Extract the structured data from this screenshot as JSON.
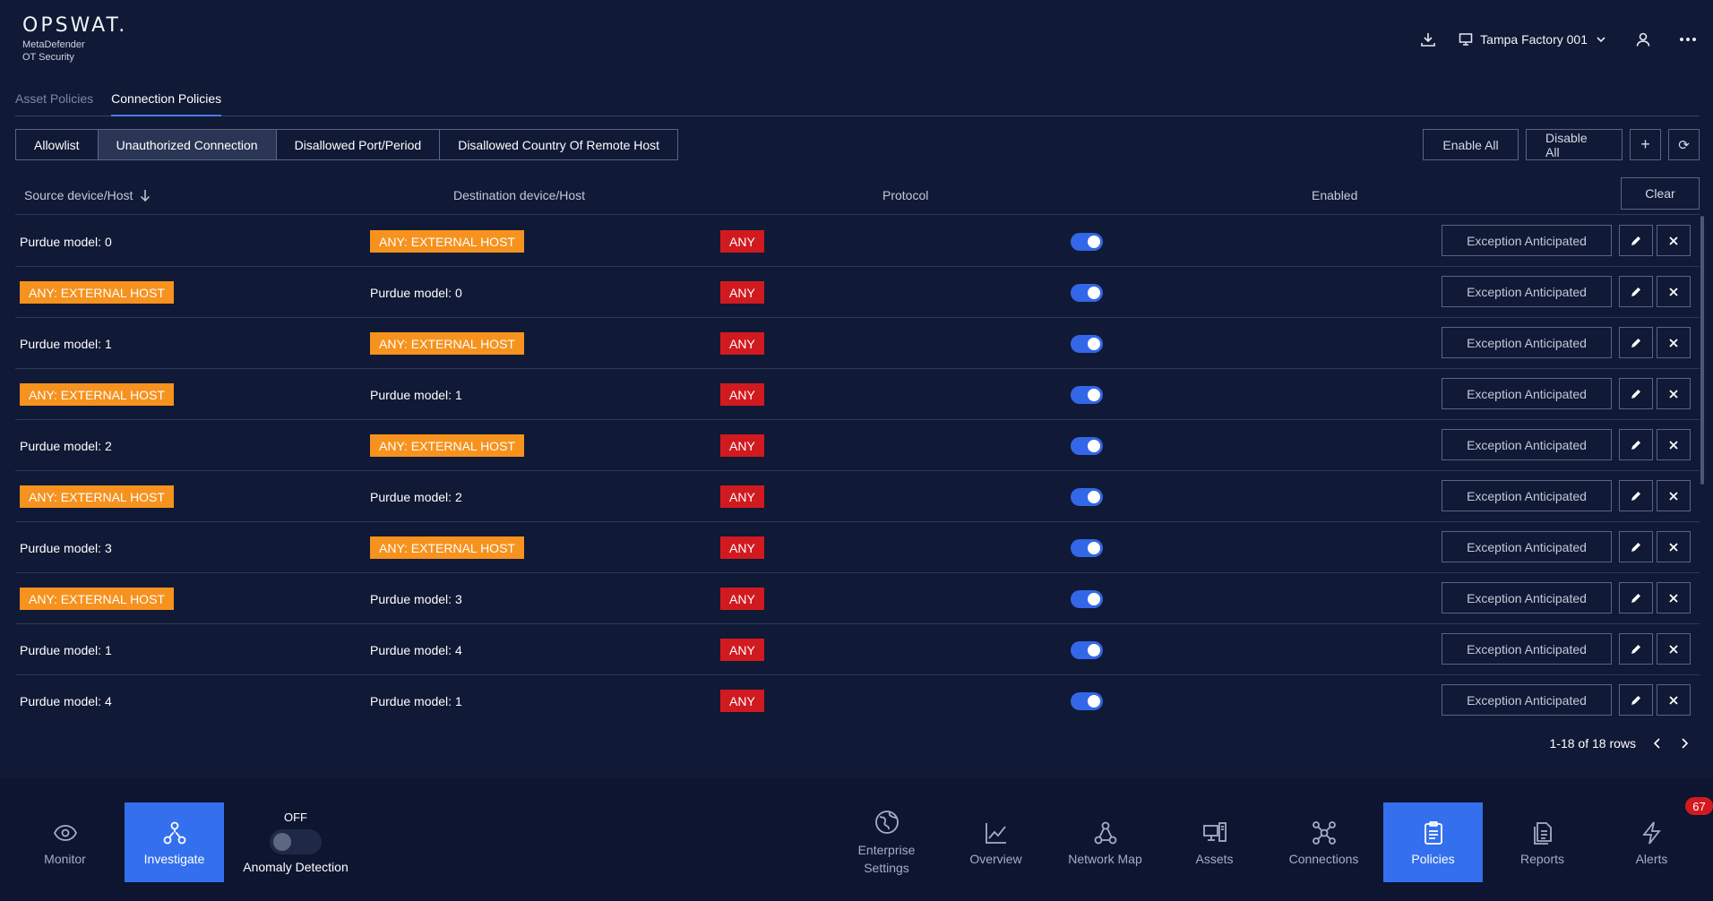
{
  "brand": {
    "name": "OPSWAT.",
    "product_line1": "MetaDefender",
    "product_line2": "OT Security"
  },
  "header": {
    "site": "Tampa Factory 001"
  },
  "tabs": [
    {
      "label": "Asset Policies",
      "active": false
    },
    {
      "label": "Connection Policies",
      "active": true
    }
  ],
  "policy_types": [
    {
      "label": "Allowlist",
      "active": false
    },
    {
      "label": "Unauthorized Connection",
      "active": true
    },
    {
      "label": "Disallowed Port/Period",
      "active": false
    },
    {
      "label": "Disallowed Country Of Remote Host",
      "active": false
    }
  ],
  "toolbar": {
    "enable_all": "Enable All",
    "disable_all": "Disable All",
    "add_symbol": "+",
    "refresh_symbol": "⟳"
  },
  "table": {
    "columns": {
      "source": "Source device/Host",
      "destination": "Destination device/Host",
      "protocol": "Protocol",
      "enabled": "Enabled"
    },
    "clear_label": "Clear",
    "exception_label": "Exception Anticipated",
    "rows": [
      {
        "source": "Purdue model: 0",
        "source_external": false,
        "destination": "ANY: EXTERNAL HOST",
        "destination_external": true,
        "protocol": "ANY",
        "enabled": true
      },
      {
        "source": "ANY: EXTERNAL HOST",
        "source_external": true,
        "destination": "Purdue model: 0",
        "destination_external": false,
        "protocol": "ANY",
        "enabled": true
      },
      {
        "source": "Purdue model: 1",
        "source_external": false,
        "destination": "ANY: EXTERNAL HOST",
        "destination_external": true,
        "protocol": "ANY",
        "enabled": true
      },
      {
        "source": "ANY: EXTERNAL HOST",
        "source_external": true,
        "destination": "Purdue model: 1",
        "destination_external": false,
        "protocol": "ANY",
        "enabled": true
      },
      {
        "source": "Purdue model: 2",
        "source_external": false,
        "destination": "ANY: EXTERNAL HOST",
        "destination_external": true,
        "protocol": "ANY",
        "enabled": true
      },
      {
        "source": "ANY: EXTERNAL HOST",
        "source_external": true,
        "destination": "Purdue model: 2",
        "destination_external": false,
        "protocol": "ANY",
        "enabled": true
      },
      {
        "source": "Purdue model: 3",
        "source_external": false,
        "destination": "ANY: EXTERNAL HOST",
        "destination_external": true,
        "protocol": "ANY",
        "enabled": true
      },
      {
        "source": "ANY: EXTERNAL HOST",
        "source_external": true,
        "destination": "Purdue model: 3",
        "destination_external": false,
        "protocol": "ANY",
        "enabled": true
      },
      {
        "source": "Purdue model: 1",
        "source_external": false,
        "destination": "Purdue model: 4",
        "destination_external": false,
        "protocol": "ANY",
        "enabled": true
      },
      {
        "source": "Purdue model: 4",
        "source_external": false,
        "destination": "Purdue model: 1",
        "destination_external": false,
        "protocol": "ANY",
        "enabled": true
      }
    ]
  },
  "pagination": {
    "label": "1-18 of 18 rows"
  },
  "bottom_nav": {
    "left": [
      {
        "key": "monitor",
        "label": "Monitor",
        "icon": "eye-icon",
        "active": false
      },
      {
        "key": "investigate",
        "label": "Investigate",
        "icon": "hierarchy-icon",
        "active": true
      }
    ],
    "anomaly": {
      "state": "OFF",
      "label": "Anomaly Detection"
    },
    "right": [
      {
        "key": "enterprise-settings",
        "label": "Enterprise Settings",
        "icon": "globe-icon",
        "active": false
      },
      {
        "key": "overview",
        "label": "Overview",
        "icon": "line-chart-icon",
        "active": false
      },
      {
        "key": "network-map",
        "label": "Network Map",
        "icon": "network-icon",
        "active": false
      },
      {
        "key": "assets",
        "label": "Assets",
        "icon": "devices-icon",
        "active": false
      },
      {
        "key": "connections",
        "label": "Connections",
        "icon": "connections-icon",
        "active": false
      },
      {
        "key": "policies",
        "label": "Policies",
        "icon": "clipboard-icon",
        "active": true
      },
      {
        "key": "reports",
        "label": "Reports",
        "icon": "reports-icon",
        "active": false
      },
      {
        "key": "alerts",
        "label": "Alerts",
        "icon": "lightning-icon",
        "active": false
      }
    ],
    "alerts_badge": "67"
  },
  "colors": {
    "background": "#101935",
    "accent": "#3470ee",
    "external_tag": "#f6921e",
    "protocol_tag": "#d11a1f",
    "toggle_on": "#3367e8"
  }
}
